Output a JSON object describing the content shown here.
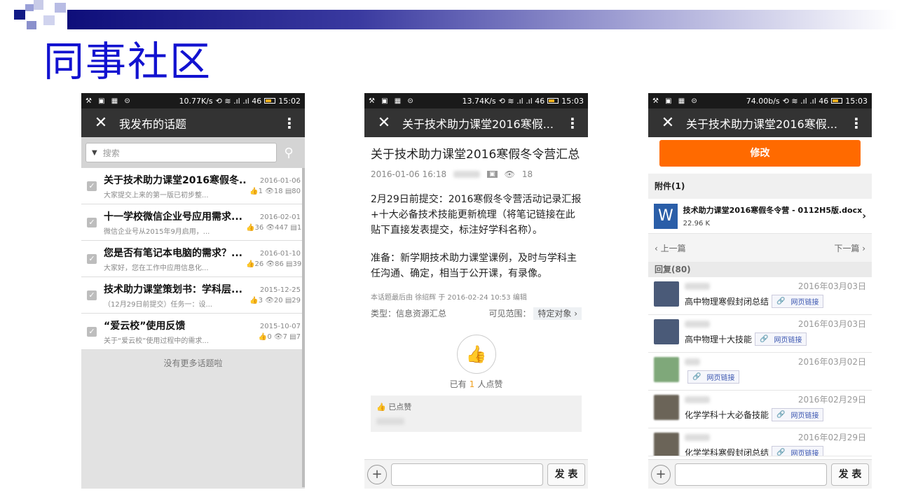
{
  "slide": {
    "title": "同事社区"
  },
  "phone1": {
    "status": {
      "icons": "⚒ ▣ ▦ ⊝",
      "speed": "10.77K/s",
      "net": "⟲ ≋ .ıl .ıl 46",
      "time": "15:02"
    },
    "title": "我发布的话题",
    "search_placeholder": "搜索",
    "topics": [
      {
        "title": "关于技术助力课堂2016寒假冬...",
        "summary": "大家提交上来的第一版已初步整...",
        "date": "2016-01-06",
        "likes": "1",
        "views": "18",
        "comments": "80"
      },
      {
        "title": "十一学校微信企业号应用需求...",
        "summary": "微信企业号从2015年9月启用，...",
        "date": "2016-02-01",
        "likes": "36",
        "views": "447",
        "comments": "1"
      },
      {
        "title": "您是否有笔记本电脑的需求？...",
        "summary": "大家好，您在工作中应用信息化...",
        "date": "2016-01-10",
        "likes": "26",
        "views": "86",
        "comments": "39"
      },
      {
        "title": "技术助力课堂策划书：学科层...",
        "summary": "（12月29日前提交）任务一：设...",
        "date": "2015-12-25",
        "likes": "3",
        "views": "20",
        "comments": "29"
      },
      {
        "title": "“爱云校”使用反馈",
        "summary": "关于“爱云校”使用过程中的需求...",
        "date": "2015-10-07",
        "likes": "0",
        "views": "7",
        "comments": "7"
      }
    ],
    "no_more": "没有更多话题啦"
  },
  "phone2": {
    "status": {
      "icons": "⚒ ▣ ▦ ⊝",
      "speed": "13.74K/s",
      "net": "⟲ ≋ .ıl .ıl 46",
      "time": "15:03"
    },
    "title": "关于技术助力课堂2016寒假...",
    "article_title": "关于技术助力课堂2016寒假冬令营汇总",
    "datetime": "2016-01-06 16:18",
    "views": "18",
    "paragraph1": "2月29日前提交：2016寒假冬令营活动记录汇报+十大必备技术技能更新梳理（将笔记链接在此贴下直接发表提交，标注好学科名称）。",
    "paragraph2": "准备：新学期技术助力课堂课例，及时与学科主任沟通、确定，相当于公开课，有录像。",
    "edit_note": "本话题最后由 徐绍辉 于 2016-02-24 10:53 编辑",
    "type_label": "类型：信息资源汇总",
    "scope_label": "可见范围：",
    "scope_value": "特定对象",
    "like_prefix": "已有",
    "like_count": "1",
    "like_suffix": "人点赞",
    "liked_label": "已点赞",
    "send_label": "发 表"
  },
  "phone3": {
    "status": {
      "icons": "⚒ ▣ ▦ ⊝",
      "speed": "74.00b/s",
      "net": "⟲ ≋ .ıl .ıl 46",
      "time": "15:03"
    },
    "title": "关于技术助力课堂2016寒假...",
    "edit_label": "修改",
    "attachments_header": "附件(1)",
    "attachment_name": "技术助力课堂2016寒假冬令营 - 0112H5版.docx",
    "attachment_size": "22.96 K",
    "attachment_icon_letter": "W",
    "prev_label": "上一篇",
    "next_label": "下一篇",
    "replies_header": "回复(80)",
    "link_label": "网页链接",
    "replies": [
      {
        "date": "2016年03月03日",
        "text": "高中物理寒假封闭总结",
        "avatar_color": "#4a5a78"
      },
      {
        "date": "2016年03月03日",
        "text": "高中物理十大技能",
        "avatar_color": "#4a5a78"
      },
      {
        "date": "2016年03月02日",
        "text": "",
        "avatar_color": "#7fa87a"
      },
      {
        "date": "2016年02月29日",
        "text": "化学学科十大必备技能",
        "avatar_color": "#6b6458"
      },
      {
        "date": "2016年02月29日",
        "text": "化学学科寒假封闭总结",
        "avatar_color": "#6b6458"
      }
    ],
    "send_label": "发 表"
  }
}
